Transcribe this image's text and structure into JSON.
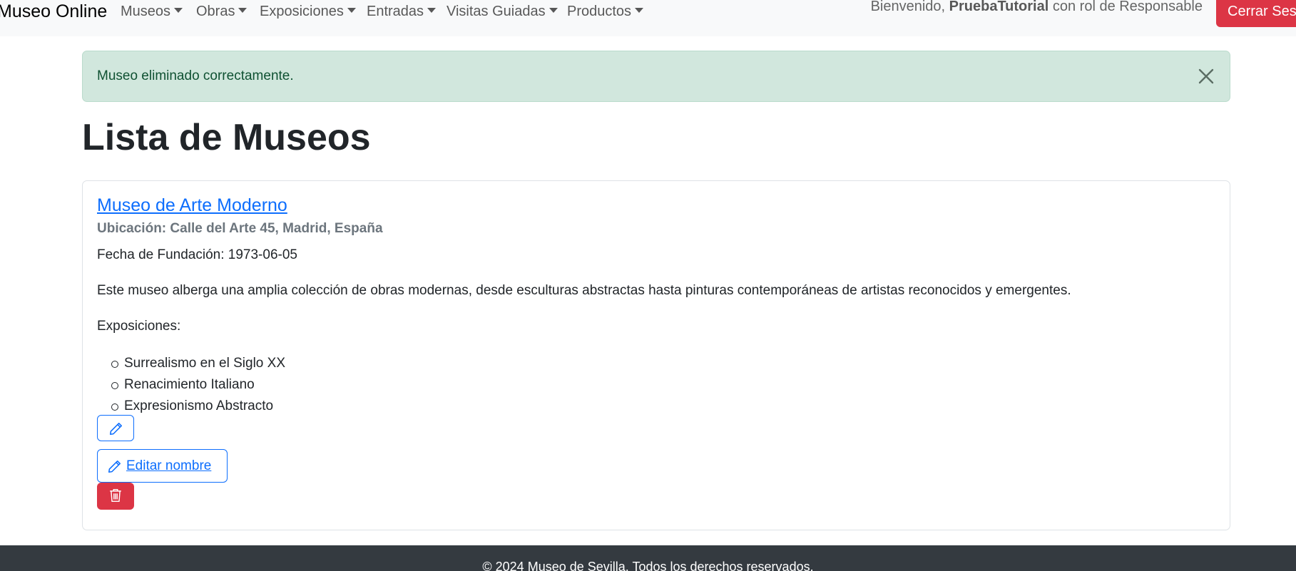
{
  "navbar": {
    "brand": "Museo Online",
    "menus": [
      {
        "label": "Museos"
      },
      {
        "label": "Obras"
      },
      {
        "label": "Exposiciones"
      },
      {
        "label": "Entradas"
      },
      {
        "label": "Visitas Guiadas"
      },
      {
        "label": "Productos"
      }
    ],
    "welcome_prefix": "Bienvenido, ",
    "username": "PruebaTutorial",
    "welcome_suffix": " con rol de Responsable",
    "logout_label": "Cerrar Sesión"
  },
  "alert": {
    "message": "Museo eliminado correctamente.",
    "close_icon": "close-icon"
  },
  "page": {
    "title": "Lista de Museos"
  },
  "museum": {
    "name": "Museo de Arte Moderno",
    "location": "Ubicación: Calle del Arte 45, Madrid, España",
    "founded": "Fecha de Fundación: 1973-06-05",
    "description": "Este museo alberga una amplia colección de obras modernas, desde esculturas abstractas hasta pinturas contemporáneas de artistas reconocidos y emergentes.",
    "exhibitions_label": "Exposiciones:",
    "exhibitions": [
      "Surrealismo en el Siglo XX",
      "Renacimiento Italiano",
      "Expresionismo Abstracto"
    ],
    "edit_icon": "pencil-icon",
    "edit_name_label": " Editar nombre",
    "delete_icon": "trash-icon"
  },
  "colors": {
    "primary": "#0d6efd",
    "danger": "#dc3545",
    "success_bg": "#d1e7dd",
    "footer_bg": "#343a40"
  },
  "footer": {
    "text": "© 2024 Museo de Sevilla. Todos los derechos reservados."
  }
}
